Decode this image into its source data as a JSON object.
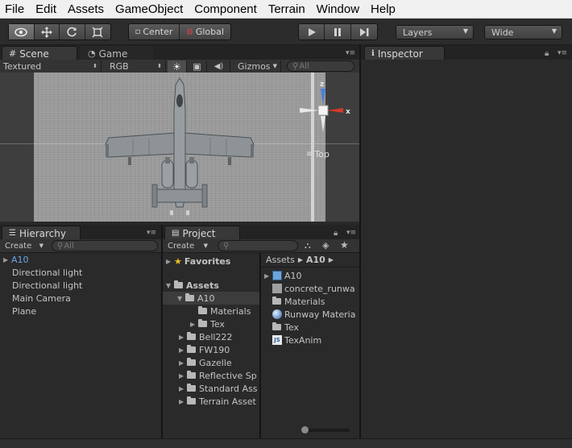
{
  "menu": [
    "File",
    "Edit",
    "Assets",
    "GameObject",
    "Component",
    "Terrain",
    "Window",
    "Help"
  ],
  "toolbar": {
    "transform_tools": [
      "hand-icon",
      "move-icon",
      "rotate-icon",
      "scale-icon"
    ],
    "pivot_label": "Center",
    "space_label": "Global",
    "play_controls": [
      "play-icon",
      "pause-icon",
      "step-icon"
    ],
    "layers_label": "Layers",
    "layout_label": "Wide"
  },
  "scene": {
    "tabs": [
      "Scene",
      "Game"
    ],
    "render_mode": "Textured",
    "color_mode": "RGB",
    "gizmos_label": "Gizmos",
    "search_placeholder": "All",
    "view_label": "Top",
    "axis_labels": {
      "y": "z",
      "x": "x"
    }
  },
  "inspector": {
    "tab": "Inspector"
  },
  "hierarchy": {
    "tab": "Hierarchy",
    "create_label": "Create",
    "search_placeholder": "All",
    "items": [
      "A10",
      "Directional light",
      "Directional light",
      "Main Camera",
      "Plane"
    ]
  },
  "project": {
    "tab": "Project",
    "create_label": "Create",
    "favorites_label": "Favorites",
    "assets_label": "Assets",
    "tree": [
      "A10",
      "Materials",
      "Tex",
      "Bell222",
      "FW190",
      "Gazelle",
      "Reflective Sp",
      "Standard Ass",
      "Terrain Asset"
    ],
    "breadcrumb": [
      "Assets",
      "A10"
    ],
    "files": [
      "A10",
      "concrete_runwa",
      "Materials",
      "Runway Materia",
      "Tex",
      "TexAnim"
    ]
  },
  "colors": {
    "selection_text": "#6aa5e8",
    "axis_x": "#d43a2a",
    "axis_z": "#4a7ed8",
    "accent_yellow": "#f0c020"
  }
}
